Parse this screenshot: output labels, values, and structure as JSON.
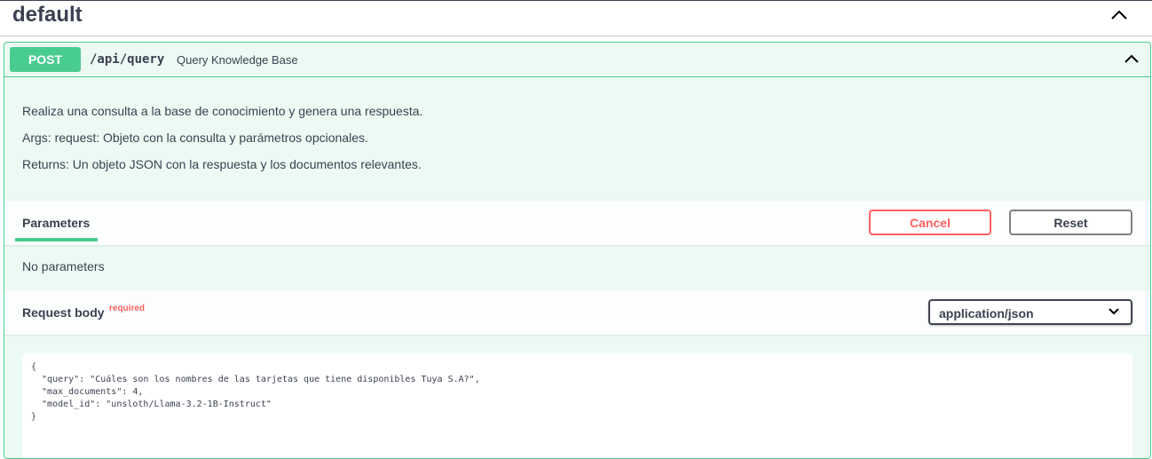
{
  "section": {
    "title": "default"
  },
  "operation": {
    "method": "POST",
    "path": "/api/query",
    "summary": "Query Knowledge Base",
    "description": [
      "Realiza una consulta a la base de conocimiento y genera una respuesta.",
      "Args: request: Objeto con la consulta y parámetros opcionales.",
      "Returns: Un objeto JSON con la respuesta y los documentos relevantes."
    ],
    "colors": {
      "post": "#49cc90",
      "cancel": "#ff6060",
      "text": "#3b4151"
    }
  },
  "parameters": {
    "tab_label": "Parameters",
    "cancel_label": "Cancel",
    "reset_label": "Reset",
    "empty_text": "No parameters"
  },
  "request_body": {
    "title": "Request body",
    "required_label": "required",
    "content_type": "application/json",
    "body": "{\n  \"query\": \"Cuáles son los nombres de las tarjetas que tiene disponibles Tuya S.A?\",\n  \"max_documents\": 4,\n  \"model_id\": \"unsloth/Llama-3.2-1B-Instruct\"\n}"
  },
  "icons": {
    "section_toggle": "chevron-up-icon",
    "operation_toggle": "chevron-up-icon",
    "select_arrow": "chevron-down-icon"
  }
}
